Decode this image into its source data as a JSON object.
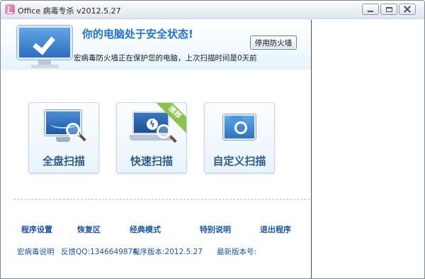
{
  "window": {
    "title": "Office 病毒专杀 v2012.5.27",
    "controls": [
      "minimize",
      "maximize",
      "close"
    ]
  },
  "header": {
    "status_title": "你的电脑处于安全状态!",
    "status_desc": "宏病毒防火墙正在保护您的电脑，上次扫描时间是0天前",
    "firewall_button": "停用防火墙",
    "icon": "monitor-check-icon"
  },
  "scan_buttons": [
    {
      "label": "全盘扫描",
      "icon": "monitor-magnifier-icon"
    },
    {
      "label": "快速扫描",
      "icon": "laptop-lightning-icon",
      "badge": "推荐"
    },
    {
      "label": "自定义扫描",
      "icon": "folder-target-icon"
    }
  ],
  "links": {
    "settings": "程序设置",
    "restore": "恢复区",
    "classic_mode": "经典模式",
    "special_notes": "特别说明",
    "exit": "退出程序"
  },
  "info": {
    "macro_virus_help": "宏病毒说明",
    "feedback": "反馈QQ:1346649874",
    "program_version": "程序版本:2012.5.27",
    "latest_version": "最新版本号:"
  },
  "colors": {
    "accent_blue": "#2175d6",
    "link_blue": "#1e56a8",
    "badge_green": "#8bc34a"
  }
}
